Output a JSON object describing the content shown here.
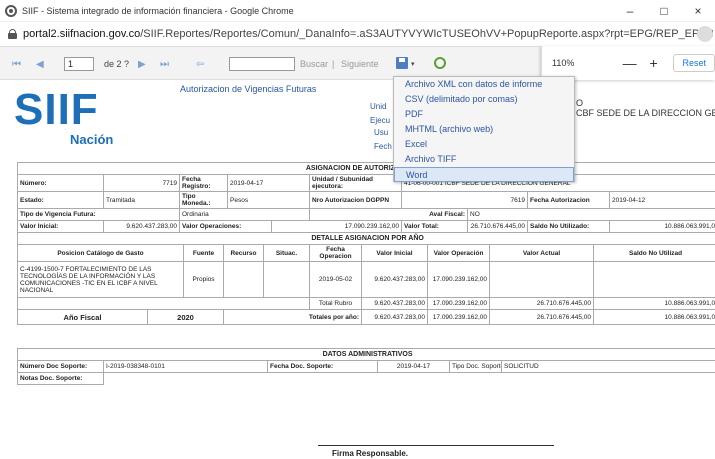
{
  "window": {
    "title": "SIIF - Sistema integrado de información financiera - Google Chrome",
    "min": "–",
    "max": "□",
    "close": "×"
  },
  "address": {
    "host": "portal2.siifnacion.gov.co",
    "path": "/SIIF.Reportes/Reportes/Comun/_DanaInfo=.aS3AUTYVYWIcTUSEOhVV+PopupReporte.aspx?rpt=EPG/REP_EPG019_Autoriza..."
  },
  "toolbar": {
    "page": "1",
    "of_pages": "de 2 ?",
    "find": "Buscar",
    "sep": "|",
    "next": "Siguiente"
  },
  "zoom": {
    "value": "110%",
    "minus": "—",
    "plus": "+",
    "reset": "Reset"
  },
  "export_menu": {
    "items": [
      "Archivo XML con datos de informe",
      "CSV (delimitado por comas)",
      "PDF",
      "MHTML (archivo web)",
      "Excel",
      "Archivo TIFF",
      "Word"
    ],
    "selected": "Word"
  },
  "header": {
    "logo_top": "SIIF",
    "logo_bottom": "Nación",
    "title": "Autorizacion de Vigencias Futuras",
    "lbl_unidad": "Unid",
    "lbl_ejecutora": "Ejecu",
    "lbl_usu": "Usu",
    "lbl_fecha": "Fech",
    "value": "CBF SEDE DE LA DIRECCION GENE",
    "value_prefix": "O"
  },
  "report": {
    "sec_asignacion": "ASIGNACION DE AUTORIZACION DE",
    "numero_lbl": "Número:",
    "numero": "7719",
    "fecha_registro_lbl": "Fecha Registro:",
    "fecha_registro": "2019-04-17",
    "unidad_lbl": "Unidad / Subunidad ejecutora:",
    "unidad": "41-06-00-001 ICBF SEDE DE LA DIRECCIÓN GENERAL",
    "estado_lbl": "Estado:",
    "estado": "Tramitada",
    "tipo_moneda_lbl": "Tipo Moneda.:",
    "tipo_moneda": "Pesos",
    "nro_aut_lbl": "Nro Autorizacion DGPPN",
    "nro_aut": "7619",
    "fecha_aut_lbl": "Fecha Autorizacion",
    "fecha_aut": "2019-04-12",
    "tipo_vig_lbl": "Tipo de Vigencia Futura:",
    "tipo_vig": "Ordinaria",
    "aval_lbl": "Aval Fiscal:",
    "aval": "NO",
    "valor_inicial_lbl": "Valor Inicial:",
    "valor_inicial": "9.620.437.283,00",
    "valor_oper_lbl": "Valor Operaciones:",
    "valor_oper": "17.090.239.162,00",
    "valor_total_lbl": "Valor Total:",
    "valor_total": "26.710.676.445,00",
    "saldo_lbl": "Saldo No Utilizado:",
    "saldo": "10.886.063.991,0",
    "sec_detalle": "DETALLE ASIGNACION POR AÑO",
    "cols": [
      "Posicion Catálogo de Gasto",
      "Fuente",
      "Recurso",
      "Situac.",
      "Fecha Operacion",
      "Valor Inicial",
      "Valor Operación",
      "Valor Actual",
      "Saldo No Utilizad"
    ],
    "row_pos": "C-4199-1500-7 FORTALECIMIENTO DE LAS TECNOLOGÍAS DE LA INFORMACIÓN Y LAS COMUNICACIONES -TIC EN EL ICBF A NIVEL NACIONAL",
    "row_fuente": "Propios",
    "row_fecha": "2019-05-02",
    "row_vi": "9.620.437.283,00",
    "row_vo": "17.090.239.162,00",
    "total_rubro_lbl": "Total Rubro",
    "tr_vi": "9.620.437.283,00",
    "tr_vo": "17.090.239.162,00",
    "tr_va": "26.710.676.445,00",
    "tr_saldo": "10.886.063.991,0",
    "anio_lbl": "Año Fiscal",
    "anio": "2020",
    "totales_lbl": "Totales por año:",
    "ta_vi": "9.620.437.283,00",
    "ta_vo": "17.090.239.162,00",
    "ta_va": "26.710.676.445,00",
    "ta_saldo": "10.886.063.991,0",
    "sec_datos": "DATOS ADMINISTRATIVOS",
    "num_doc_lbl": "Número Doc Soporte:",
    "num_doc": "I-2019-038348-0101",
    "fecha_doc_lbl": "Fecha Doc. Soporte:",
    "fecha_doc": "2019-04-17",
    "tipo_doc_lbl": "Tipo Doc. Soporte:",
    "tipo_doc": "SOLICITUD",
    "notas_lbl": "Notas Doc. Soporte:",
    "firma": "Firma Responsable."
  }
}
